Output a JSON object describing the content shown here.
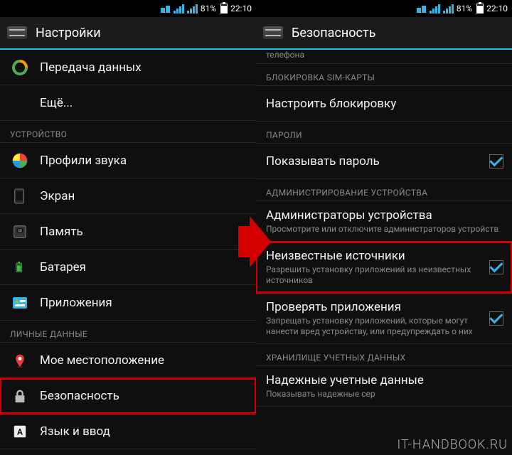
{
  "status": {
    "battery": "81%",
    "time": "22:10"
  },
  "left": {
    "title": "Настройки",
    "items": {
      "data": "Передача данных",
      "more": "Ещё...",
      "cat_device": "УСТРОЙСТВО",
      "sound": "Профили звука",
      "display": "Экран",
      "storage": "Память",
      "battery": "Батарея",
      "apps": "Приложения",
      "cat_personal": "ЛИЧНЫЕ ДАННЫЕ",
      "location": "Мое местоположение",
      "security": "Безопасность",
      "lang": "Язык и ввод"
    }
  },
  "right": {
    "title": "Безопасность",
    "partial_top": "телефона",
    "cat_sim": "БЛОКИРОВКА SIM-КАРТЫ",
    "sim_lock": "Настроить блокировку",
    "cat_pw": "ПАРОЛИ",
    "show_pw": "Показывать пароль",
    "cat_admin": "АДМИНИСТРИРОВАНИЕ УСТРОЙСТВА",
    "admins": {
      "t": "Администраторы устройства",
      "s": "Просмотрите или отключите администраторов устройств"
    },
    "unknown": {
      "t": "Неизвестные источники",
      "s": "Разрешить установку приложений из неизвестных источников"
    },
    "verify": {
      "t": "Проверять приложения",
      "s": "Запрещать установку приложений, которые могут нанести вред устройству, или предупреждать о них"
    },
    "cat_cred": "ХРАНИЛИЩЕ УЧЕТНЫХ ДАННЫХ",
    "trusted": {
      "t": "Надежные учетные данные",
      "s": "Показывать надежные сер"
    }
  },
  "watermark": "IT-HANDBOOK.RU"
}
